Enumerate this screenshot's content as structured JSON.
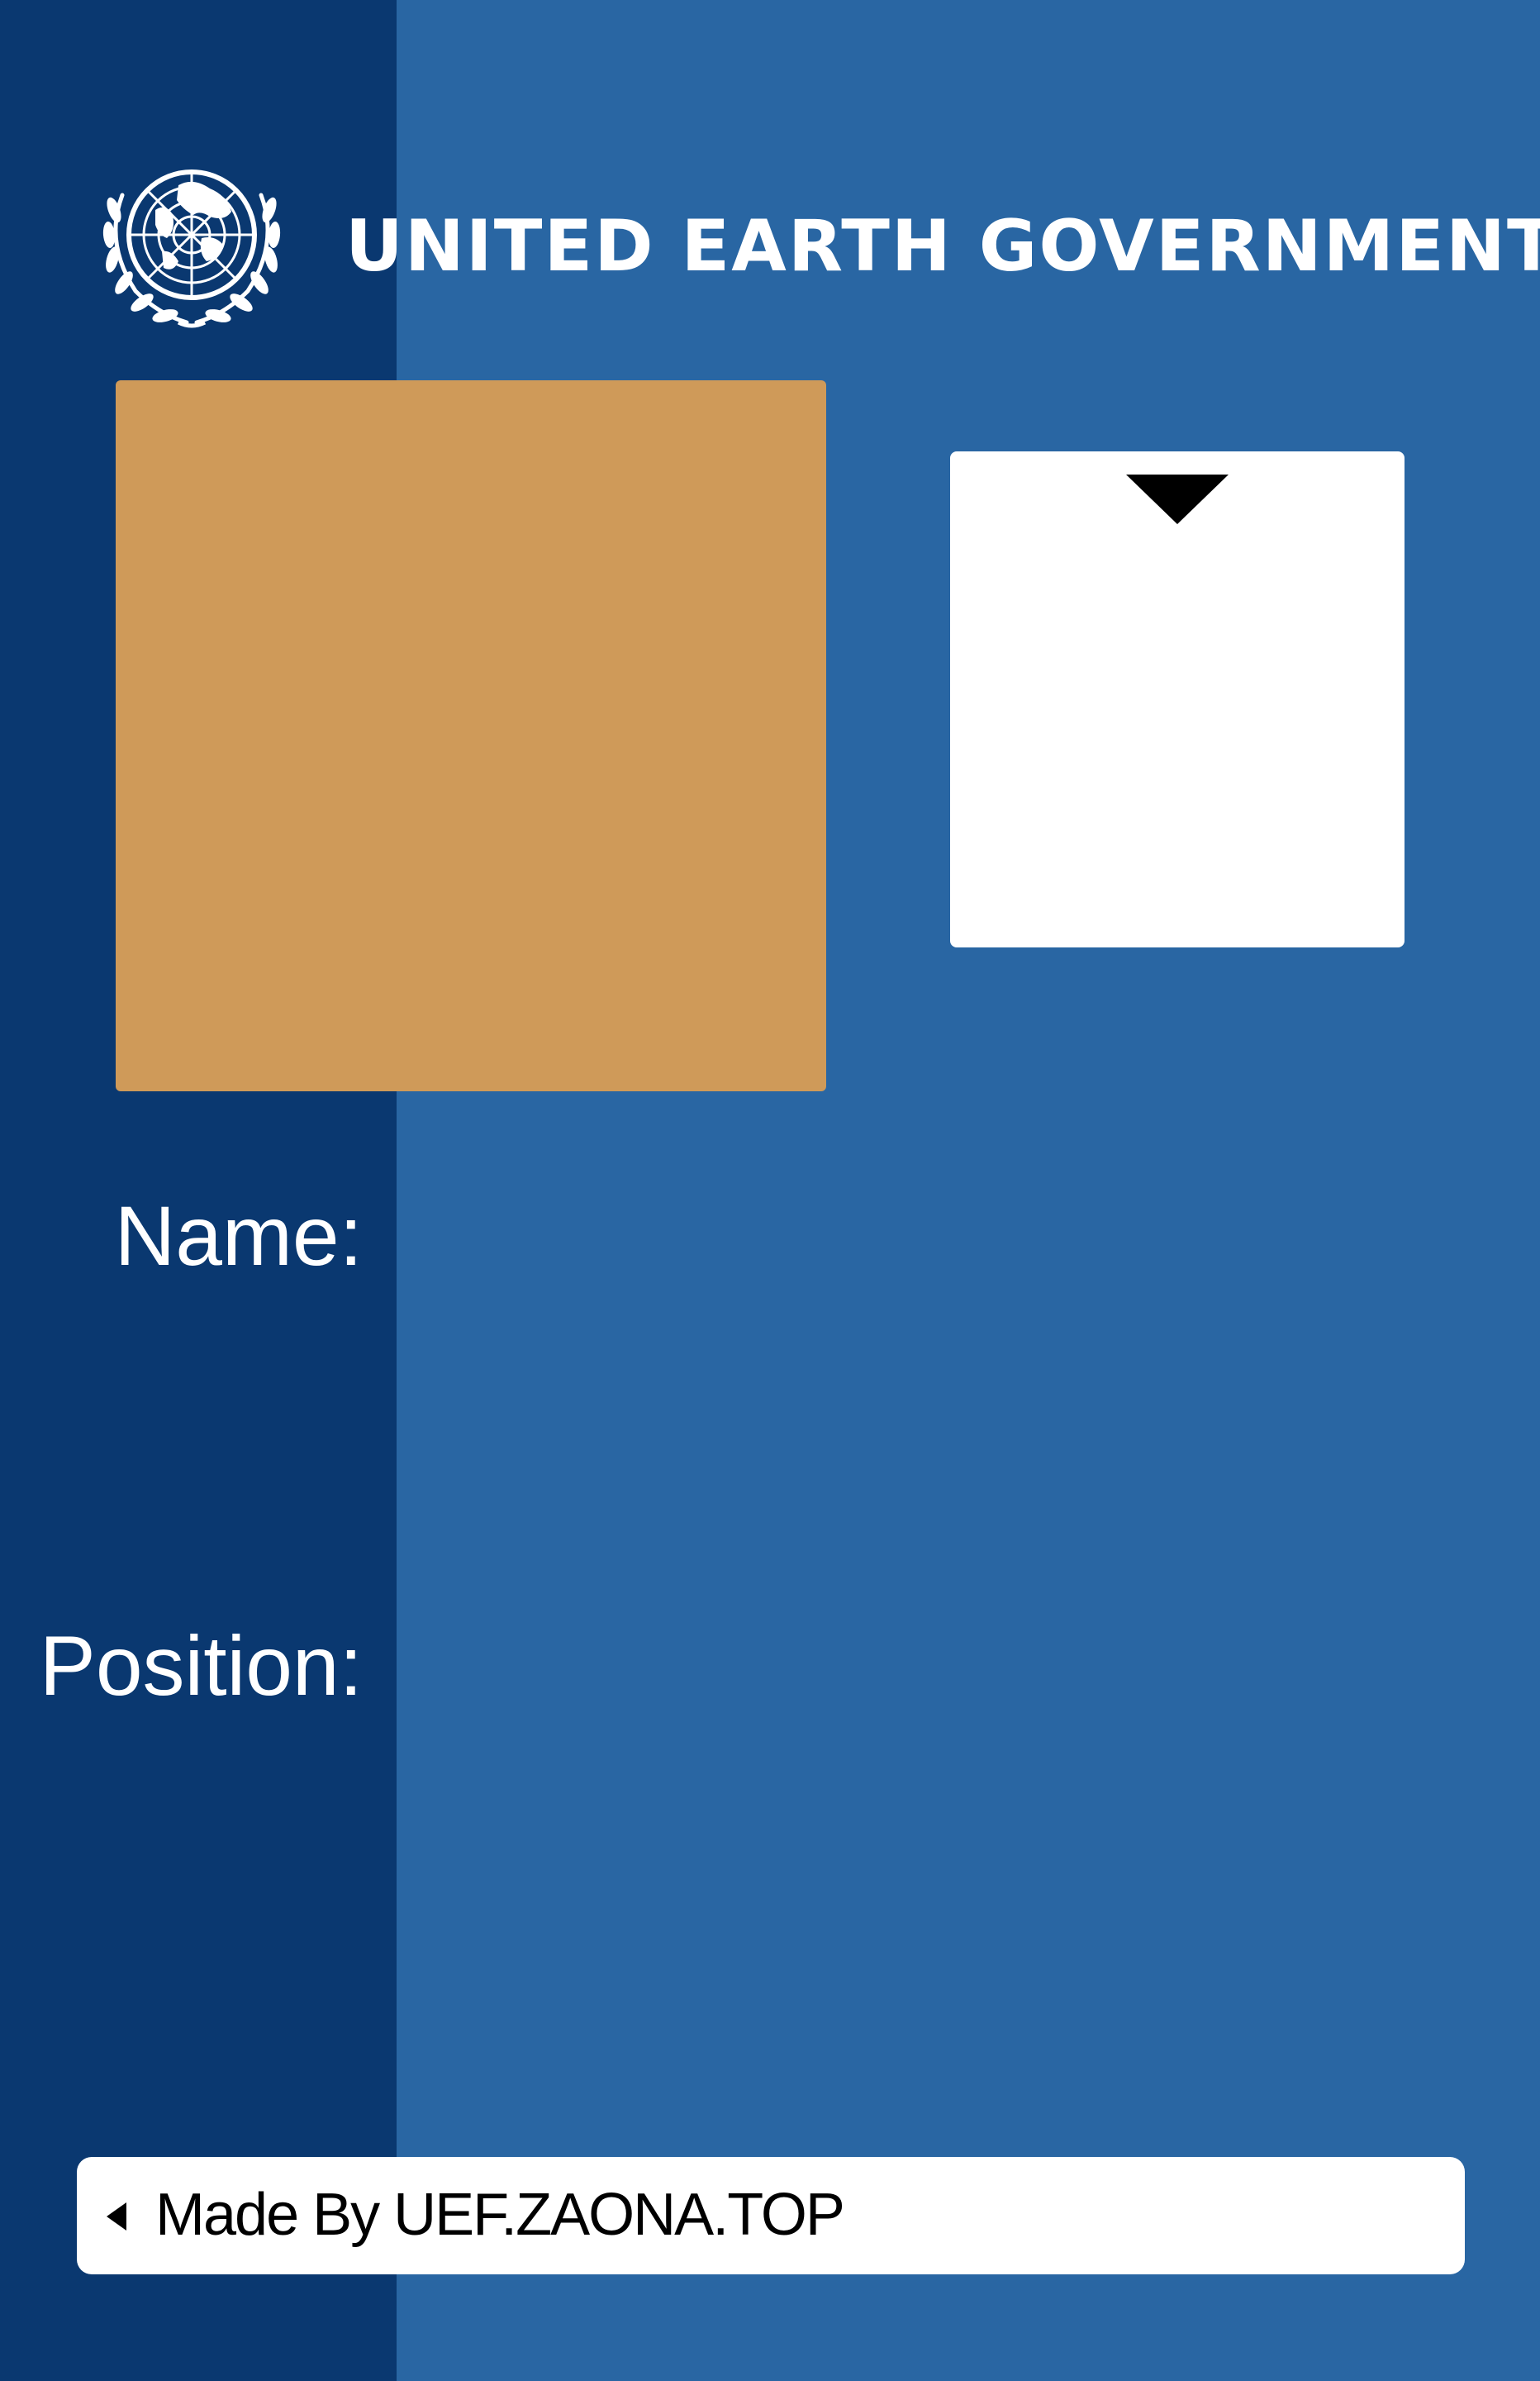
{
  "header": {
    "title": "UNITED EARTH GOVERNMENT",
    "emblem_icon": "un-emblem-icon"
  },
  "photo": {
    "color": "#cf9a59"
  },
  "fields": {
    "name_label": "Name:",
    "position_label": "Position:"
  },
  "footer": {
    "text": "Made By UEF.ZAONA.TOP",
    "arrow_icon": "triangle-left-icon"
  },
  "colors": {
    "background": "#2966a3",
    "left_band": "#0a3870",
    "photo_placeholder": "#cf9a59",
    "card": "#ffffff"
  }
}
